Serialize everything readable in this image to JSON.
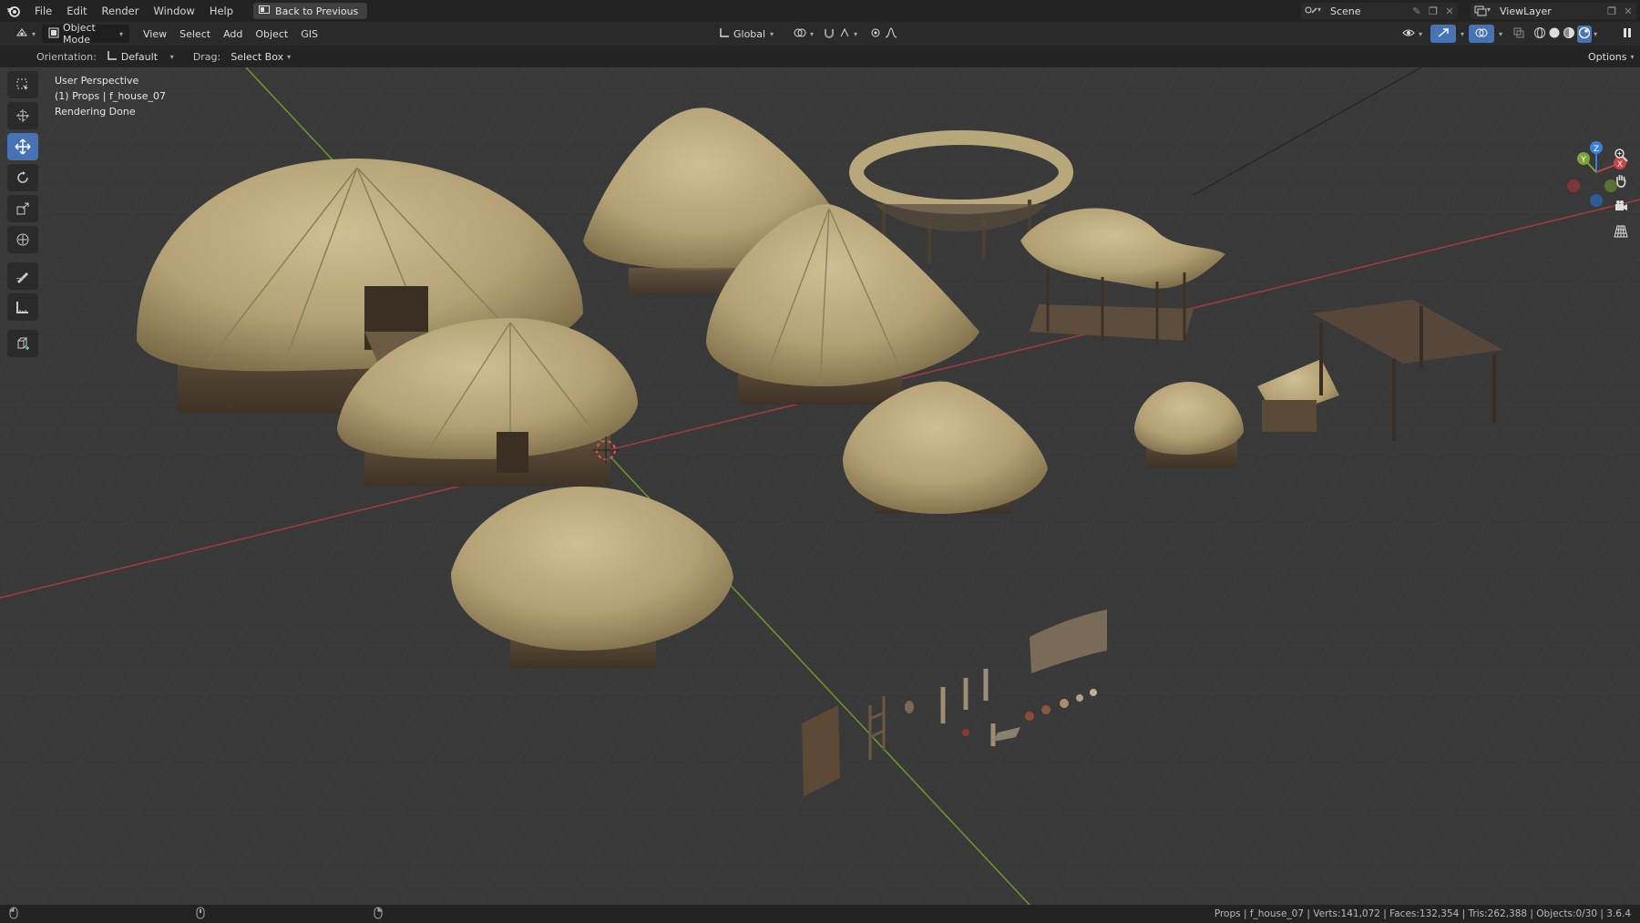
{
  "topbar": {
    "menu": [
      "File",
      "Edit",
      "Render",
      "Window",
      "Help"
    ],
    "back_button": "Back to Previous",
    "scene_name": "Scene",
    "view_layer": "ViewLayer"
  },
  "header": {
    "mode": "Object Mode",
    "menus": [
      "View",
      "Select",
      "Add",
      "Object",
      "GIS"
    ],
    "transform_orientation": "Global"
  },
  "tool_settings": {
    "orientation_label": "Orientation:",
    "orientation_value": "Default",
    "drag_label": "Drag:",
    "drag_value": "Select Box",
    "options_label": "Options"
  },
  "viewport": {
    "line1": "User Perspective",
    "line2": "(1) Props | f_house_07",
    "line3": "Rendering Done",
    "gizmo": {
      "x": "X",
      "y": "Y",
      "z": "Z"
    }
  },
  "statusbar": {
    "stats": "Props | f_house_07 | Verts:141,072 | Faces:132,354 | Tris:262,388 | Objects:0/30 | 3.6.4"
  },
  "colors": {
    "accent": "#4772b3",
    "x_axis": "#c8444a",
    "y_axis": "#7ea33a",
    "z_axis": "#3d7fd6",
    "thatch": "#b5a274"
  }
}
